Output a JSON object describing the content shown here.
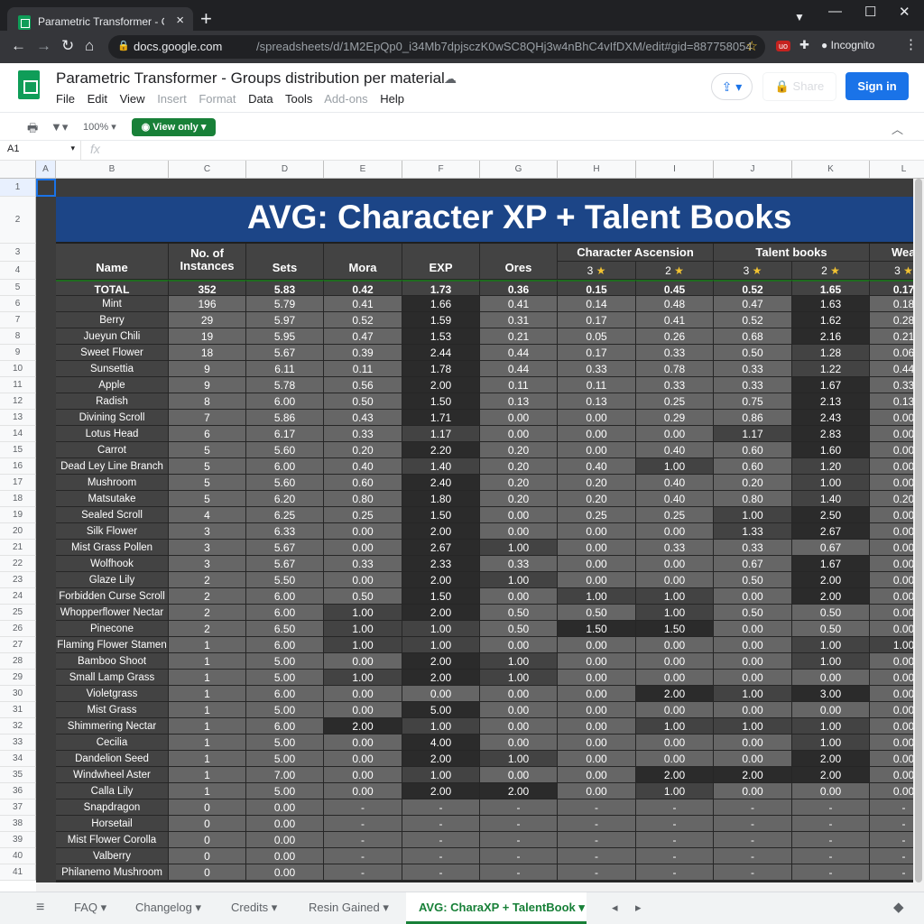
{
  "browser": {
    "tab_title": "Parametric Transformer - Groups",
    "url_host": "docs.google.com",
    "url_path": "/spreadsheets/d/1M2EpQp0_i34Mb7dpjsczK0wSC8QHj3w4nBhC4vIfDXM/edit#gid=887758054",
    "incognito_label": "Incognito"
  },
  "doc": {
    "title": "Parametric Transformer - Groups distribution per material",
    "menu": [
      "File",
      "Edit",
      "View",
      "Insert",
      "Format",
      "Data",
      "Tools",
      "Add-ons",
      "Help"
    ],
    "share_label": "Share",
    "signin_label": "Sign in",
    "zoom": "100%",
    "view_only_label": "View only",
    "namebox": "A1"
  },
  "columns": [
    "A",
    "B",
    "C",
    "D",
    "E",
    "F",
    "G",
    "H",
    "I",
    "J",
    "K",
    "L"
  ],
  "sheet": {
    "banner": "AVG: Character XP + Talent Books",
    "headers": {
      "name": "Name",
      "instances": "No. of Instances",
      "sets": "Sets",
      "mora": "Mora",
      "exp": "EXP",
      "ores": "Ores",
      "char_asc": "Character Ascension",
      "talent_books": "Talent books",
      "weapon": "Wea",
      "star3": "3",
      "star2": "2",
      "star_glyph": "★"
    },
    "total": [
      "TOTAL",
      "352",
      "5.83",
      "0.42",
      "1.73",
      "0.36",
      "0.15",
      "0.45",
      "0.52",
      "1.65",
      "0.17"
    ],
    "rows": [
      [
        "Mint",
        "196",
        "5.79",
        "0.41",
        "1.66",
        "0.41",
        "0.14",
        "0.48",
        "0.47",
        "1.63",
        "0.18"
      ],
      [
        "Berry",
        "29",
        "5.97",
        "0.52",
        "1.59",
        "0.31",
        "0.17",
        "0.41",
        "0.52",
        "1.62",
        "0.28"
      ],
      [
        "Jueyun Chili",
        "19",
        "5.95",
        "0.47",
        "1.53",
        "0.21",
        "0.05",
        "0.26",
        "0.68",
        "2.16",
        "0.21"
      ],
      [
        "Sweet Flower",
        "18",
        "5.67",
        "0.39",
        "2.44",
        "0.44",
        "0.17",
        "0.33",
        "0.50",
        "1.28",
        "0.06"
      ],
      [
        "Sunsettia",
        "9",
        "6.11",
        "0.11",
        "1.78",
        "0.44",
        "0.33",
        "0.78",
        "0.33",
        "1.22",
        "0.44"
      ],
      [
        "Apple",
        "9",
        "5.78",
        "0.56",
        "2.00",
        "0.11",
        "0.11",
        "0.33",
        "0.33",
        "1.67",
        "0.33"
      ],
      [
        "Radish",
        "8",
        "6.00",
        "0.50",
        "1.50",
        "0.13",
        "0.13",
        "0.25",
        "0.75",
        "2.13",
        "0.13"
      ],
      [
        "Divining Scroll",
        "7",
        "5.86",
        "0.43",
        "1.71",
        "0.00",
        "0.00",
        "0.29",
        "0.86",
        "2.43",
        "0.00"
      ],
      [
        "Lotus Head",
        "6",
        "6.17",
        "0.33",
        "1.17",
        "0.00",
        "0.00",
        "0.00",
        "1.17",
        "2.83",
        "0.00"
      ],
      [
        "Carrot",
        "5",
        "5.60",
        "0.20",
        "2.20",
        "0.20",
        "0.00",
        "0.40",
        "0.60",
        "1.60",
        "0.00"
      ],
      [
        "Dead Ley Line Branch",
        "5",
        "6.00",
        "0.40",
        "1.40",
        "0.20",
        "0.40",
        "1.00",
        "0.60",
        "1.20",
        "0.00"
      ],
      [
        "Mushroom",
        "5",
        "5.60",
        "0.60",
        "2.40",
        "0.20",
        "0.20",
        "0.40",
        "0.20",
        "1.00",
        "0.00"
      ],
      [
        "Matsutake",
        "5",
        "6.20",
        "0.80",
        "1.80",
        "0.20",
        "0.20",
        "0.40",
        "0.80",
        "1.40",
        "0.20"
      ],
      [
        "Sealed Scroll",
        "4",
        "6.25",
        "0.25",
        "1.50",
        "0.00",
        "0.25",
        "0.25",
        "1.00",
        "2.50",
        "0.00"
      ],
      [
        "Silk Flower",
        "3",
        "6.33",
        "0.00",
        "2.00",
        "0.00",
        "0.00",
        "0.00",
        "1.33",
        "2.67",
        "0.00"
      ],
      [
        "Mist Grass Pollen",
        "3",
        "5.67",
        "0.00",
        "2.67",
        "1.00",
        "0.00",
        "0.33",
        "0.33",
        "0.67",
        "0.00"
      ],
      [
        "Wolfhook",
        "3",
        "5.67",
        "0.33",
        "2.33",
        "0.33",
        "0.00",
        "0.00",
        "0.67",
        "1.67",
        "0.00"
      ],
      [
        "Glaze Lily",
        "2",
        "5.50",
        "0.00",
        "2.00",
        "1.00",
        "0.00",
        "0.00",
        "0.50",
        "2.00",
        "0.00"
      ],
      [
        "Forbidden Curse Scroll",
        "2",
        "6.00",
        "0.50",
        "1.50",
        "0.00",
        "1.00",
        "1.00",
        "0.00",
        "2.00",
        "0.00"
      ],
      [
        "Whopperflower Nectar",
        "2",
        "6.00",
        "1.00",
        "2.00",
        "0.50",
        "0.50",
        "1.00",
        "0.50",
        "0.50",
        "0.00"
      ],
      [
        "Pinecone",
        "2",
        "6.50",
        "1.00",
        "1.00",
        "0.50",
        "1.50",
        "1.50",
        "0.00",
        "0.50",
        "0.00"
      ],
      [
        "Flaming Flower Stamen",
        "1",
        "6.00",
        "1.00",
        "1.00",
        "0.00",
        "0.00",
        "0.00",
        "0.00",
        "1.00",
        "1.00"
      ],
      [
        "Bamboo Shoot",
        "1",
        "5.00",
        "0.00",
        "2.00",
        "1.00",
        "0.00",
        "0.00",
        "0.00",
        "1.00",
        "0.00"
      ],
      [
        "Small Lamp Grass",
        "1",
        "5.00",
        "1.00",
        "2.00",
        "1.00",
        "0.00",
        "0.00",
        "0.00",
        "0.00",
        "0.00"
      ],
      [
        "Violetgrass",
        "1",
        "6.00",
        "0.00",
        "0.00",
        "0.00",
        "0.00",
        "2.00",
        "1.00",
        "3.00",
        "0.00"
      ],
      [
        "Mist Grass",
        "1",
        "5.00",
        "0.00",
        "5.00",
        "0.00",
        "0.00",
        "0.00",
        "0.00",
        "0.00",
        "0.00"
      ],
      [
        "Shimmering Nectar",
        "1",
        "6.00",
        "2.00",
        "1.00",
        "0.00",
        "0.00",
        "1.00",
        "1.00",
        "1.00",
        "0.00"
      ],
      [
        "Cecilia",
        "1",
        "5.00",
        "0.00",
        "4.00",
        "0.00",
        "0.00",
        "0.00",
        "0.00",
        "1.00",
        "0.00"
      ],
      [
        "Dandelion Seed",
        "1",
        "5.00",
        "0.00",
        "2.00",
        "1.00",
        "0.00",
        "0.00",
        "0.00",
        "2.00",
        "0.00"
      ],
      [
        "Windwheel Aster",
        "1",
        "7.00",
        "0.00",
        "1.00",
        "0.00",
        "0.00",
        "2.00",
        "2.00",
        "2.00",
        "0.00"
      ],
      [
        "Calla Lily",
        "1",
        "5.00",
        "0.00",
        "2.00",
        "2.00",
        "0.00",
        "1.00",
        "0.00",
        "0.00",
        "0.00"
      ],
      [
        "Snapdragon",
        "0",
        "0.00",
        "-",
        "-",
        "-",
        "-",
        "-",
        "-",
        "-",
        "-"
      ],
      [
        "Horsetail",
        "0",
        "0.00",
        "-",
        "-",
        "-",
        "-",
        "-",
        "-",
        "-",
        "-"
      ],
      [
        "Mist Flower Corolla",
        "0",
        "0.00",
        "-",
        "-",
        "-",
        "-",
        "-",
        "-",
        "-",
        "-"
      ],
      [
        "Valberry",
        "0",
        "0.00",
        "-",
        "-",
        "-",
        "-",
        "-",
        "-",
        "-",
        "-"
      ],
      [
        "Philanemo Mushroom",
        "0",
        "0.00",
        "-",
        "-",
        "-",
        "-",
        "-",
        "-",
        "-",
        "-"
      ]
    ]
  },
  "sheet_tabs": [
    "FAQ",
    "Changelog",
    "Credits",
    "Resin Gained",
    "AVG: CharaXP + TalentBook"
  ]
}
